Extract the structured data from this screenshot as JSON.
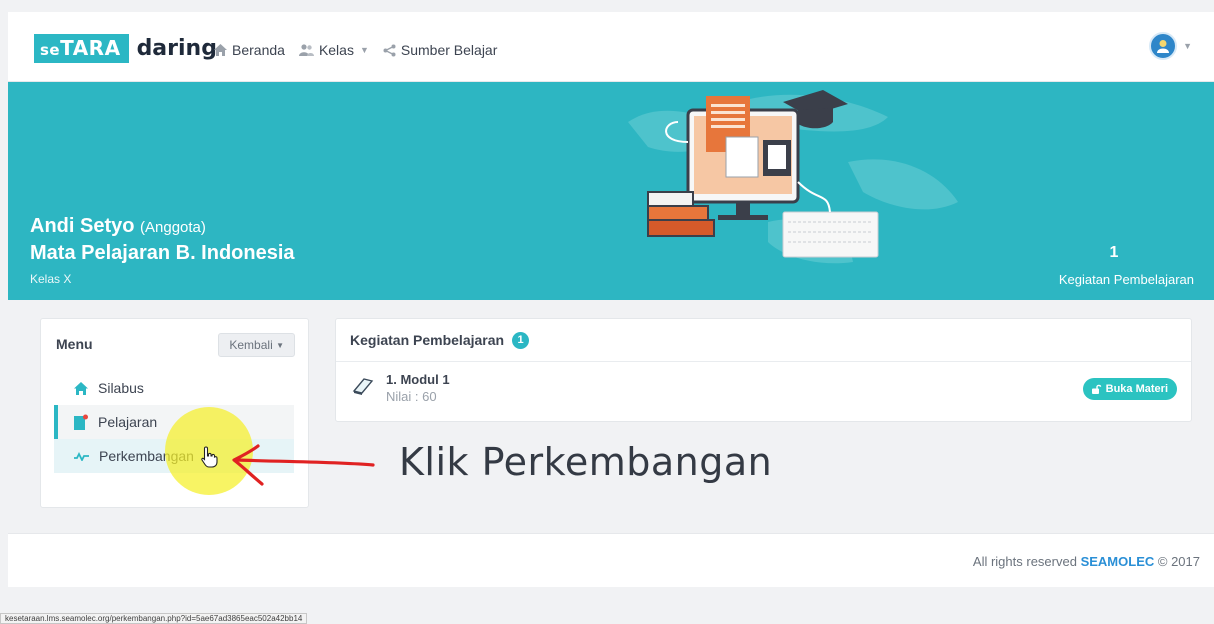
{
  "brand": {
    "logo_box": "seTARA",
    "logo_box_prefix": "se",
    "logo_box_main": "TARA",
    "logo_rest": "daring",
    "color": "#2bb7c4"
  },
  "nav": {
    "beranda": "Beranda",
    "kelas": "Kelas",
    "sumber": "Sumber Belajar"
  },
  "banner": {
    "name": "Andi Setyo",
    "role": "(Anggota)",
    "subject": "Mata Pelajaran B. Indonesia",
    "kelas": "Kelas X",
    "count": "1",
    "count_label": "Kegiatan Pembelajaran",
    "color": "#2db6c2"
  },
  "menu": {
    "title": "Menu",
    "back_label": "Kembali",
    "items": [
      {
        "label": "Silabus",
        "icon": "home-icon"
      },
      {
        "label": "Pelajaran",
        "icon": "book-icon"
      },
      {
        "label": "Perkembangan",
        "icon": "chart-line-icon"
      }
    ]
  },
  "annotation": {
    "text": "Klik Perkembangan"
  },
  "kegiatan": {
    "title": "Kegiatan Pembelajaran",
    "badge": "1",
    "rows": [
      {
        "title": "1. Modul 1",
        "nilai": "Nilai : 60",
        "action": "Buka Materi"
      }
    ]
  },
  "footer": {
    "prefix": "All rights reserved",
    "brand": "SEAMOLEC",
    "suffix": "© 2017"
  },
  "statusbar": {
    "url": "kesetaraan.lms.seamolec.org/perkembangan.php?id=5ae67ad3865eac502a42bb14"
  }
}
